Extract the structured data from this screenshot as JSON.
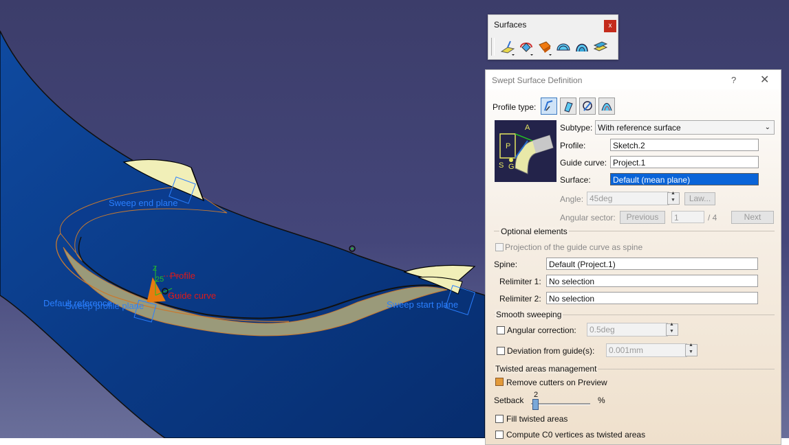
{
  "viewport": {
    "labels": {
      "sweep_end_plane": "Sweep end plane",
      "sweep_start_plane": "Sweep start plane",
      "default_reference": "Default reference",
      "sweep_profile_plane": "Sweep profile plane",
      "profile": "Profile",
      "guide_curve": "Guide curve",
      "axis_z": "Z",
      "axis_num": "25"
    },
    "colors": {
      "surface": "#0a3c8c",
      "label_blue": "#2a7fff",
      "label_red": "#e01818"
    }
  },
  "surfaces_toolbar": {
    "title": "Surfaces",
    "close": "x",
    "icons": [
      "extrude-icon",
      "revolve-icon",
      "sphere-icon",
      "sweep-icon",
      "fill-icon",
      "offset-icon"
    ]
  },
  "dialog": {
    "title": "Swept Surface Definition",
    "help": "?",
    "close": "✕",
    "profile_type_label": "Profile type:",
    "subtype_label": "Subtype:",
    "subtype_value": "With reference surface",
    "profile_label": "Profile:",
    "profile_value": "Sketch.2",
    "guide_curve_label": "Guide curve:",
    "guide_curve_value": "Project.1",
    "surface_label": "Surface:",
    "surface_value": "Default (mean plane)",
    "angle_label": "Angle:",
    "angle_value": "45deg",
    "law_button": "Law...",
    "angular_sector_label": "Angular sector:",
    "previous_button": "Previous",
    "sector_value": "1",
    "sector_total": "/ 4",
    "next_button": "Next",
    "optional_elements": "Optional elements",
    "projection_label": "Projection of the guide curve as spine",
    "spine_label": "Spine:",
    "spine_value": "Default (Project.1)",
    "relimiter1_label": "Relimiter 1:",
    "relimiter1_value": "No selection",
    "relimiter2_label": "Relimiter 2:",
    "relimiter2_value": "No selection",
    "smooth_sweeping": "Smooth sweeping",
    "angular_correction_label": "Angular correction:",
    "angular_correction_value": "0.5deg",
    "deviation_label": "Deviation from guide(s):",
    "deviation_value": "0.001mm",
    "twisted_areas": "Twisted areas management",
    "remove_cutters_label": "Remove cutters on Preview",
    "setback_label": "Setback",
    "setback_value": "2",
    "setback_unit": "%",
    "fill_twisted_label": "Fill twisted areas",
    "compute_c0_label": "Compute C0 vertices as twisted areas",
    "preview_image_letters": {
      "a": "A",
      "p": "P",
      "s": "S",
      "g": "G"
    }
  }
}
